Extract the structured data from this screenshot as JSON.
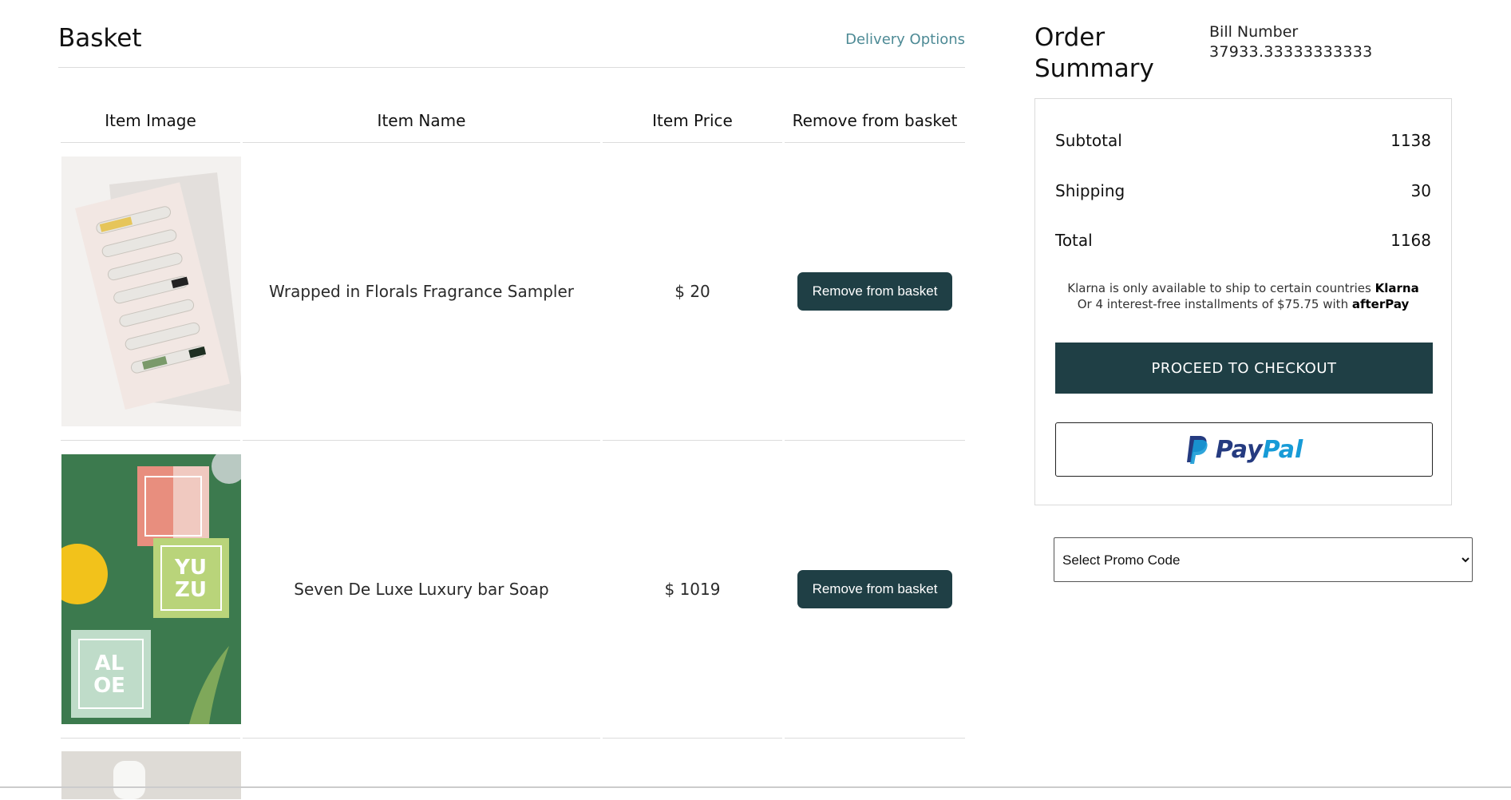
{
  "basket": {
    "title": "Basket",
    "delivery_link": "Delivery Options",
    "columns": [
      "Item Image",
      "Item Name",
      "Item Price",
      "Remove from basket"
    ],
    "items": [
      {
        "name": "Wrapped in Florals Fragrance Sampler",
        "price": "$ 20",
        "remove_label": "Remove from basket"
      },
      {
        "name": "Seven De Luxe Luxury bar Soap",
        "price": "$ 1019",
        "remove_label": "Remove from basket"
      }
    ]
  },
  "summary": {
    "title": "Order Summary",
    "bill_label": "Bill Number",
    "bill_number": "37933.33333333333",
    "subtotal_label": "Subtotal",
    "subtotal_value": "1138",
    "shipping_label": "Shipping",
    "shipping_value": "30",
    "total_label": "Total",
    "total_value": "1168",
    "klarna_text": "Klarna is only available to ship to certain countries",
    "klarna_brand": "Klarna",
    "afterpay_text": "Or 4 interest-free installments of $75.75 with",
    "afterpay_brand": "afterPay",
    "checkout_label": "PROCEED TO CHECKOUT",
    "paypal_word_1": "Pay",
    "paypal_word_2": "Pal"
  },
  "promo": {
    "selected": "Select Promo Code"
  },
  "colors": {
    "accent_dark_teal": "#1f3f45",
    "link_teal": "#4d8a95",
    "paypal_navy": "#253b80",
    "paypal_blue": "#179bd7"
  }
}
